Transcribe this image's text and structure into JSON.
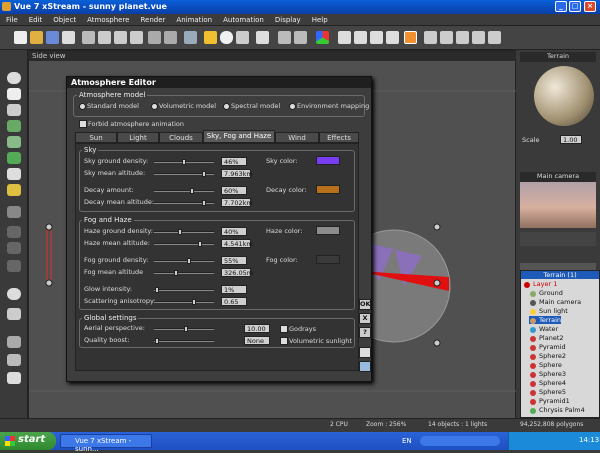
{
  "window": {
    "title": "Vue 7 xStream - sunny planet.vue"
  },
  "menu": [
    "File",
    "Edit",
    "Object",
    "Atmosphere",
    "Render",
    "Animation",
    "Automation",
    "Display",
    "Help"
  ],
  "viewport": {
    "title": "Side view"
  },
  "dialog": {
    "title": "Atmosphere Editor",
    "model_group": "Atmosphere model",
    "models": [
      "Standard model",
      "Volumetric model",
      "Spectral model",
      "Environment mapping"
    ],
    "forbid_animation": "Forbid atmosphere animation",
    "tabs": [
      "Sun",
      "Light",
      "Clouds",
      "Sky, Fog and Haze",
      "Wind",
      "Effects"
    ],
    "active_tab": "Sky, Fog and Haze",
    "sky": {
      "label": "Sky",
      "ground_density_label": "Sky ground density:",
      "ground_density": "46%",
      "mean_altitude_label": "Sky mean altitude:",
      "mean_altitude": "7.963km",
      "decay_amount_label": "Decay amount:",
      "decay_amount": "60%",
      "decay_altitude_label": "Decay mean altitude:",
      "decay_altitude": "7.702km",
      "sky_color_label": "Sky color:",
      "sky_color": "#7a3cf0",
      "decay_color_label": "Decay color:",
      "decay_color": "#b8701a"
    },
    "fog": {
      "label": "Fog and Haze",
      "haze_density_label": "Haze ground density:",
      "haze_density": "40%",
      "haze_altitude_label": "Haze mean altitude:",
      "haze_altitude": "4.541km",
      "fog_density_label": "Fog ground density:",
      "fog_density": "55%",
      "fog_altitude_label": "Fog mean altitude",
      "fog_altitude": "326.05m",
      "glow_label": "Glow intensity:",
      "glow": "1%",
      "scatter_label": "Scattering anisotropy:",
      "scatter": "0.65",
      "haze_color_label": "Haze color:",
      "haze_color": "#8c8c8c",
      "fog_color_label": "Fog color:",
      "fog_color": "#3a3a3a"
    },
    "global": {
      "label": "Global settings",
      "aerial_label": "Aerial perspective:",
      "aerial": "10.00",
      "quality_label": "Quality boost:",
      "quality": "None",
      "godrays": "Godrays",
      "volumetric_sunlight": "Volumetric sunlight"
    },
    "side_buttons": [
      "OK",
      "X",
      "?"
    ]
  },
  "right_panel": {
    "material_label": "Terrain",
    "scale_label": "Scale",
    "scale_value": "1.00",
    "camera_label": "Main camera",
    "layer_header": "Terrain (1)",
    "layers": [
      "Layer 1",
      "Ground",
      "Main camera",
      "Sun light",
      "Terrain",
      "Water",
      "Planet2",
      "Pyramid",
      "Sphere2",
      "Sphere",
      "Sphere3",
      "Sphere4",
      "Sphere5",
      "Pyramid1",
      "Chrysis Palm4"
    ]
  },
  "status": {
    "cpu": "2 CPU",
    "zoom": "Zoom : 256%",
    "objects": "14 objects : 1 lights",
    "polygons": "94,252,808 polygons"
  },
  "taskbar": {
    "start": "start",
    "item": "Vue 7 xStream - sunn...",
    "lang": "EN",
    "time": "14:13"
  }
}
